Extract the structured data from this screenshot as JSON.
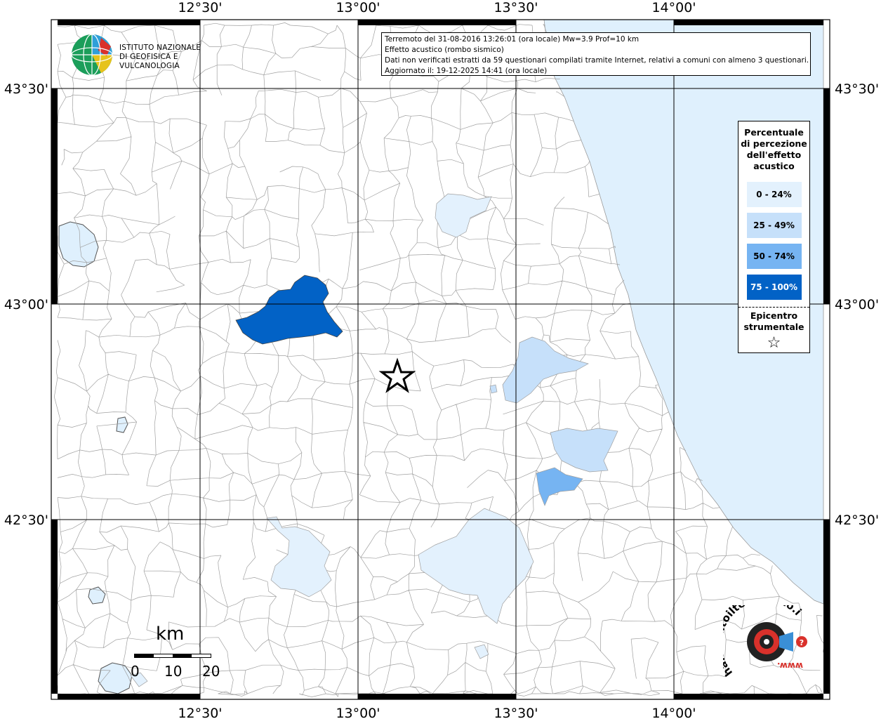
{
  "map": {
    "top_ticks": [
      "12°30'",
      "13°00'",
      "13°30'",
      "14°00'"
    ],
    "bottom_ticks": [
      "12°30'",
      "13°00'",
      "13°30'",
      "14°00'"
    ],
    "left_ticks": [
      "43°30'",
      "43°00'",
      "42°30'"
    ],
    "right_ticks": [
      "43°30'",
      "43°00'",
      "42°30'"
    ],
    "colors": {
      "sea": "#dff0fd",
      "class_0_24": "#e3f1fd",
      "class_25_49": "#c6e0fa",
      "class_50_74": "#76b4f2",
      "class_75_100": "#0262c6",
      "boundary": "#9a9a9a",
      "grid": "#000000"
    }
  },
  "institute": {
    "line1": "ISTITUTO NAZIONALE",
    "line2": "DI GEOFISICA E VULCANOLOGIA"
  },
  "info": {
    "line1": "Terremoto del 31-08-2016 13:26:01 (ora locale) Mw=3.9 Prof=10 km",
    "line2": "Effetto acustico (rombo sismico)",
    "line3": "Dati non verificati estratti da 59 questionari compilati tramite Internet, relativi a comuni con almeno 3 questionari.",
    "line4": "Aggiornato il: 19-12-2025 14:41 (ora locale)"
  },
  "legend": {
    "title_1": "Percentuale",
    "title_2": "di percezione",
    "title_3": "dell'effetto",
    "title_4": "acustico",
    "classes": [
      "0 - 24%",
      "25 - 49%",
      "50 - 74%",
      "75 - 100%"
    ],
    "epicenter_1": "Epicentro",
    "epicenter_2": "strumentale",
    "star": "☆"
  },
  "scale": {
    "unit": "km",
    "labels": [
      "0",
      "10",
      "20"
    ]
  },
  "badge": {
    "text": "haisentitoilterremoto.it",
    "www": "www."
  }
}
